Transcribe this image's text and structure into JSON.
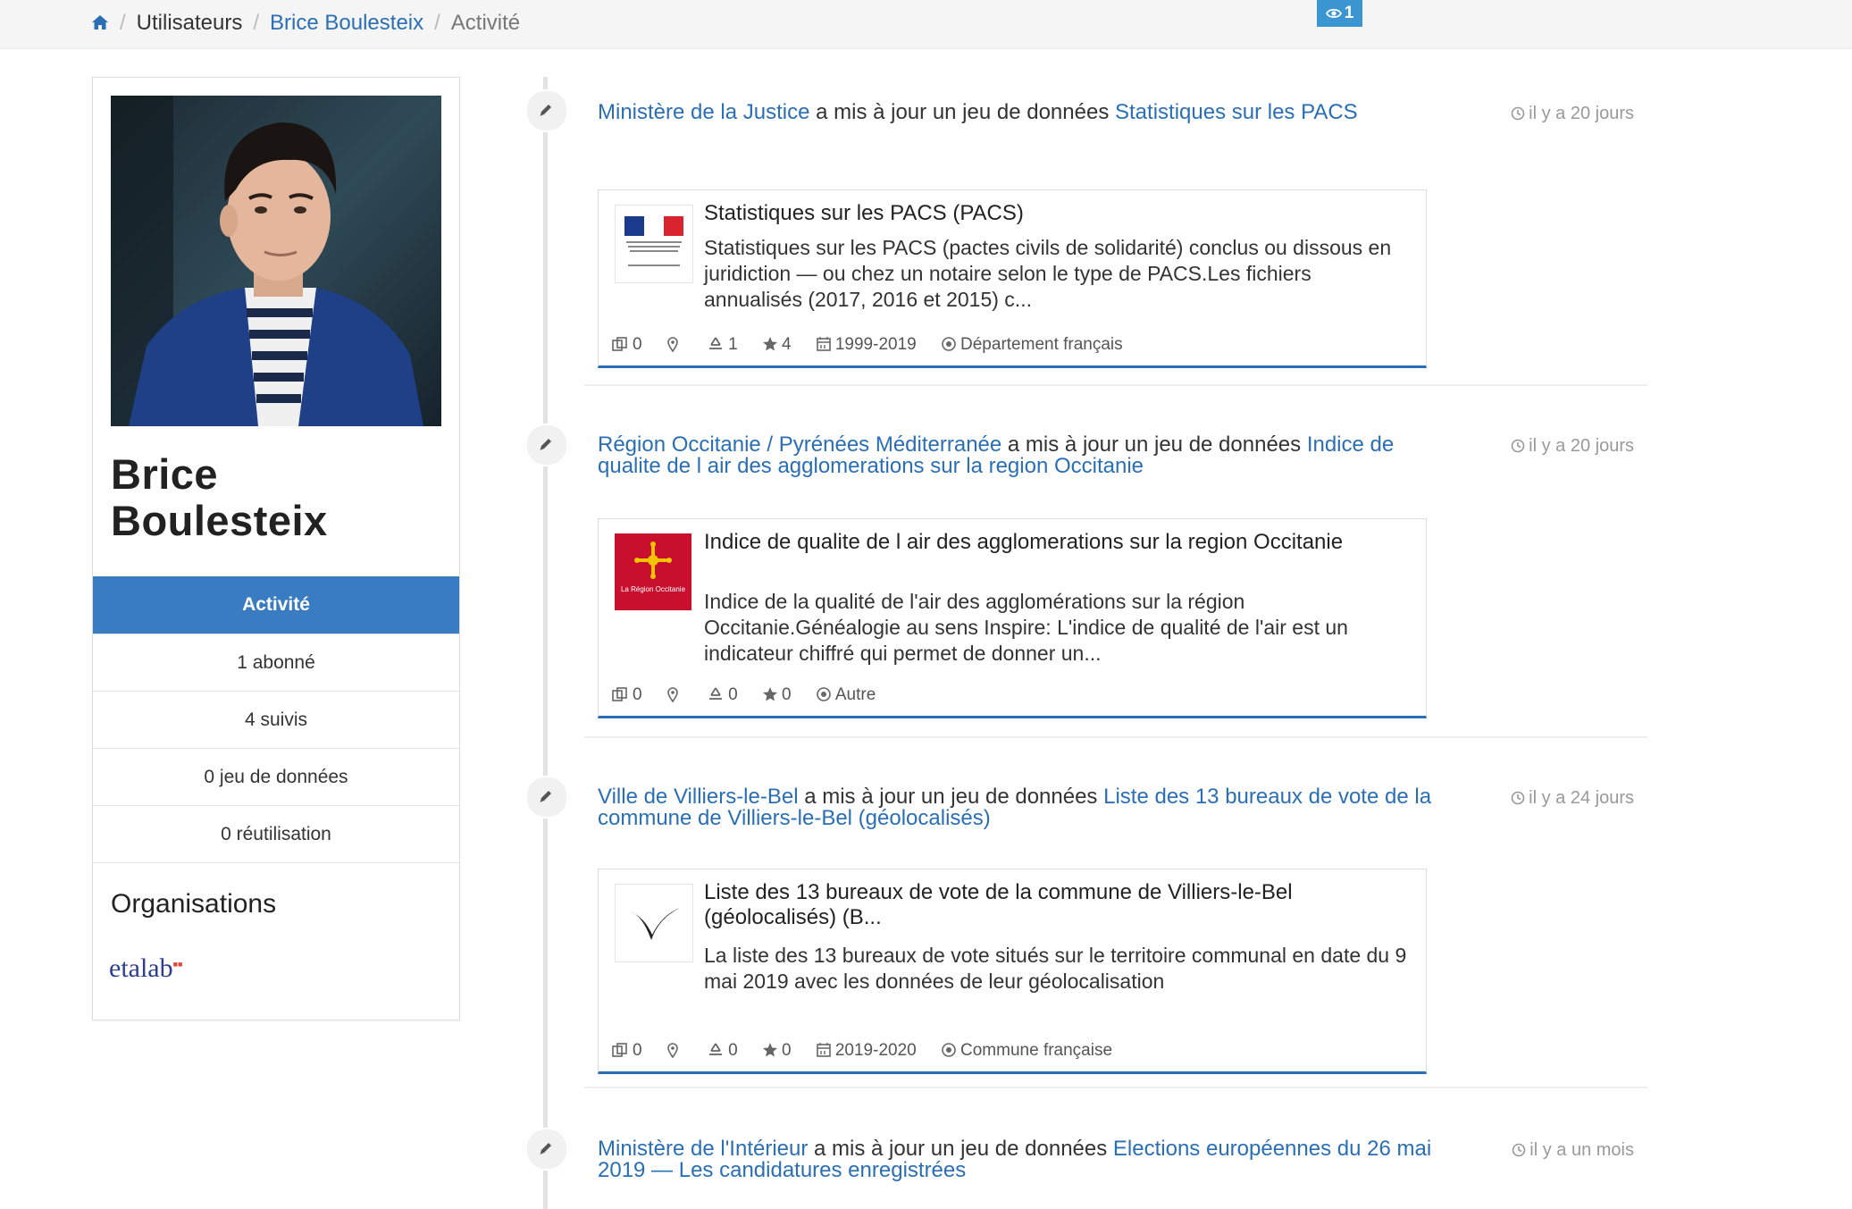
{
  "breadcrumb": {
    "home_icon": "home-icon",
    "users": "Utilisateurs",
    "user": "Brice Boulesteix",
    "current": "Activité"
  },
  "view_badge": {
    "icon": "eye-icon",
    "count": "1"
  },
  "profile": {
    "first_name": "Brice",
    "last_name": "Boulesteix",
    "menu": [
      "Activité",
      "1 abonné",
      "4 suivis",
      "0 jeu de données",
      "0 réutilisation"
    ],
    "organizations_title": "Organisations",
    "org_logo": "etalab"
  },
  "activity": [
    {
      "actor": "Ministère de la Justice",
      "action": " a mis à jour un jeu de données ",
      "object": "Statistiques sur les PACS",
      "time": "il y a 20 jours",
      "card": {
        "title": "Statistiques sur les PACS (PACS)",
        "description": "Statistiques sur les PACS (pactes civils de solidarité) conclus ou dissous en juridiction — ou chez un notaire selon le type de PACS.Les fichiers annualisés (2017, 2016 et 2015) c...",
        "reuses": "0",
        "followers": "1",
        "stars": "4",
        "period": "1999-2019",
        "granularity": "Département français"
      }
    },
    {
      "actor": "Région Occitanie / Pyrénées Méditerranée",
      "action": " a mis à jour un jeu de données ",
      "object": "Indice de qualite de l air des agglomerations sur la region Occitanie",
      "time": "il y a 20 jours",
      "card": {
        "title": "Indice de qualite de l air des agglomerations sur la region Occitanie",
        "description": "Indice de la qualité de l'air des agglomérations sur la région Occitanie.Généalogie au sens Inspire: L'indice de qualité de l'air est un indicateur chiffré qui permet de donner un...",
        "reuses": "0",
        "followers": "0",
        "stars": "0",
        "granularity": "Autre",
        "logo_text": "La Région Occitanie"
      }
    },
    {
      "actor": "Ville de Villiers-le-Bel",
      "action": " a mis à jour un jeu de données ",
      "object": "Liste des 13 bureaux de vote de la commune de Villiers-le-Bel (géolocalisés)",
      "time": "il y a 24 jours",
      "card": {
        "title": "Liste des 13 bureaux de vote de la commune de Villiers-le-Bel (géolocalisés) (B...",
        "description": "La liste des 13 bureaux de vote situés sur le territoire communal en date du 9 mai 2019 avec les données de leur géolocalisation",
        "reuses": "0",
        "followers": "0",
        "stars": "0",
        "period": "2019-2020",
        "granularity": "Commune française"
      }
    },
    {
      "actor": "Ministère de l'Intérieur",
      "action": " a mis à jour un jeu de données ",
      "object": "Elections européennes du 26 mai 2019 — Les candidatures enregistrées",
      "time": "il y a un mois"
    }
  ]
}
